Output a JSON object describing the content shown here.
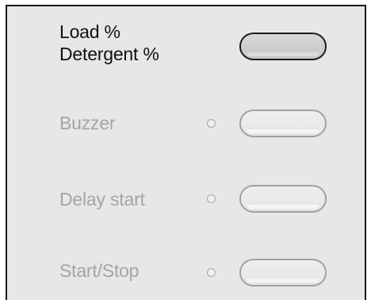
{
  "rows": [
    {
      "label_line1": "Load %",
      "label_line2": "Detergent %",
      "state": "active",
      "has_indicator": false
    },
    {
      "label": "Buzzer",
      "state": "inactive",
      "has_indicator": true
    },
    {
      "label": "Delay start",
      "state": "inactive",
      "has_indicator": true
    },
    {
      "label": "Start/Stop",
      "state": "inactive",
      "has_indicator": true
    }
  ],
  "colors": {
    "panel_background": "#e6e7e8",
    "active_text": "#111111",
    "inactive_text": "#a3a5a8",
    "panel_border": "#1a1a1a"
  },
  "icons": {
    "indicator": "indicator-led-icon"
  }
}
